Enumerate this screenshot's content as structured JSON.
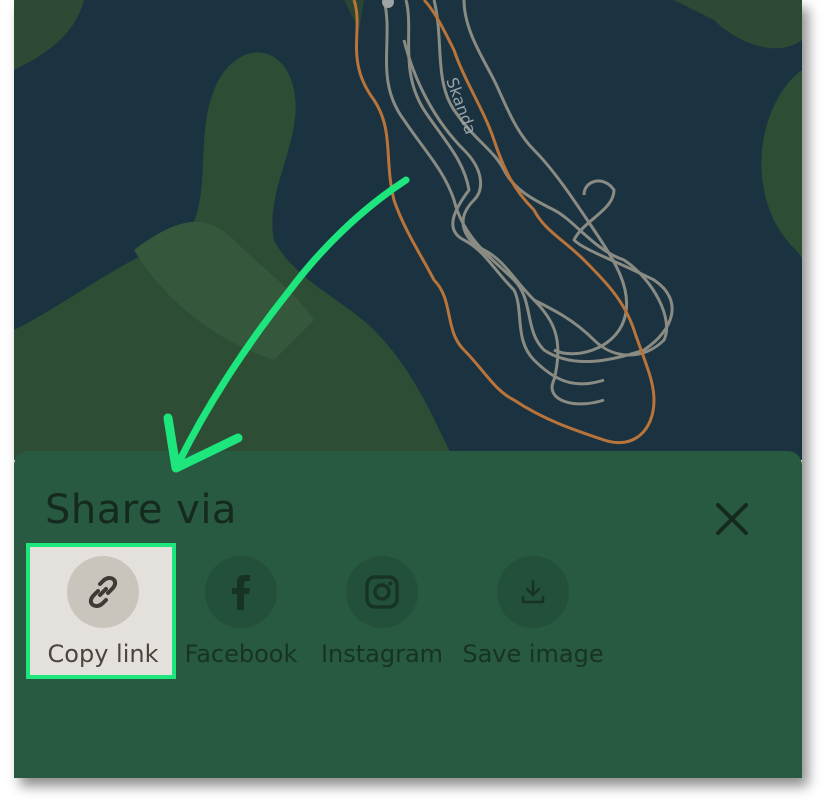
{
  "map": {
    "place_label": "Skanda",
    "water_color": "#1b3240",
    "route_color": "#b8743a",
    "track_color": "#8a8b82"
  },
  "share_sheet": {
    "title": "Share via",
    "close_icon": "close-icon",
    "options": [
      {
        "label": "Copy link",
        "icon": "link-icon"
      },
      {
        "label": "Facebook",
        "icon": "facebook-icon"
      },
      {
        "label": "Instagram",
        "icon": "instagram-icon"
      },
      {
        "label": "Save image",
        "icon": "download-icon"
      }
    ],
    "background_color": "#285941"
  },
  "annotation": {
    "arrow_color": "#1de67d",
    "highlight_target": "Copy link"
  }
}
